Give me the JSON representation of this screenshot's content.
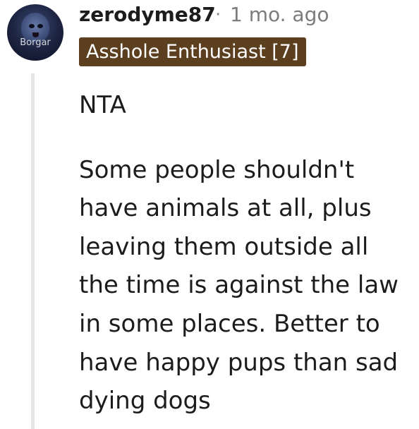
{
  "user": {
    "avatar_icon": "anime-avatar-icon",
    "avatar_text": "Borgar",
    "username": "zerodyme87",
    "separator": "·",
    "timestamp": "1 mo. ago",
    "flair": "Asshole Enthusiast [7]",
    "flair_color": "#5b3f1f"
  },
  "comment": {
    "paragraphs": [
      "NTA",
      "Some people shouldn't have animals at all, plus leaving them outside all the time is against the law in some places. Better to have happy pups than sad dying dogs"
    ]
  }
}
